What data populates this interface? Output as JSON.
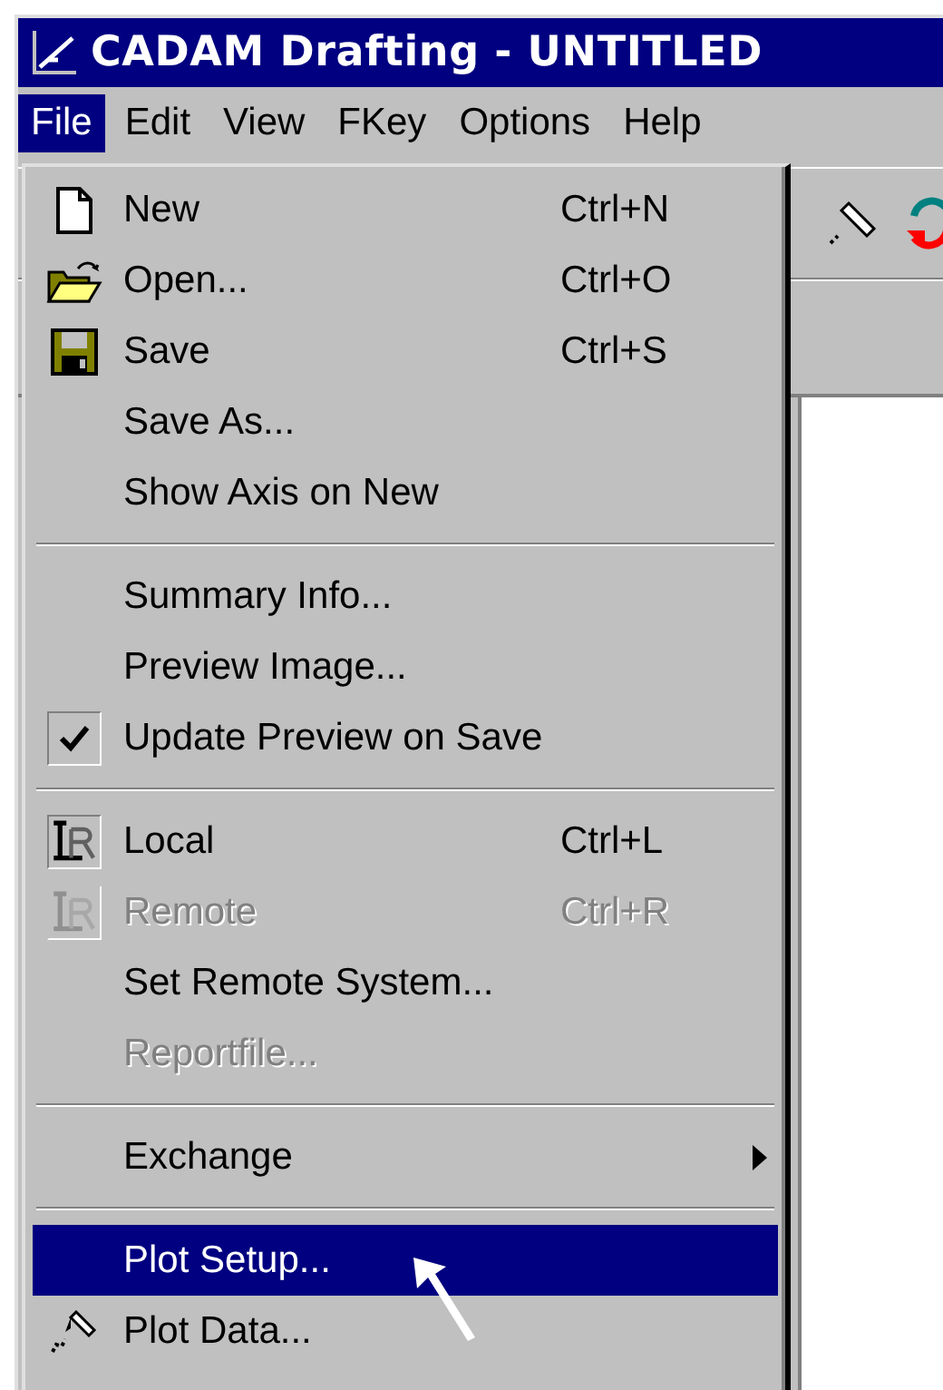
{
  "window": {
    "title": "CADAM Drafting - UNTITLED"
  },
  "menubar": [
    {
      "label": "File",
      "selected": true
    },
    {
      "label": "Edit",
      "selected": false
    },
    {
      "label": "View",
      "selected": false
    },
    {
      "label": "FKey",
      "selected": false
    },
    {
      "label": "Options",
      "selected": false
    },
    {
      "label": "Help",
      "selected": false
    }
  ],
  "file_menu": {
    "sections": [
      [
        {
          "kind": "icon",
          "label": "New",
          "shortcut": "Ctrl+N",
          "disabled": false,
          "selected": false
        },
        {
          "kind": "icon",
          "label": "Open...",
          "shortcut": "Ctrl+O",
          "disabled": false,
          "selected": false
        },
        {
          "kind": "icon",
          "label": "Save",
          "shortcut": "Ctrl+S",
          "disabled": false,
          "selected": false
        },
        {
          "kind": "plain",
          "label": "Save As...",
          "disabled": false,
          "selected": false
        },
        {
          "kind": "plain",
          "label": "Show Axis on New",
          "disabled": false,
          "selected": false
        }
      ],
      [
        {
          "kind": "plain",
          "label": "Summary Info...",
          "disabled": false,
          "selected": false
        },
        {
          "kind": "plain",
          "label": "Preview Image...",
          "disabled": false,
          "selected": false
        },
        {
          "kind": "check",
          "label": "Update Preview on Save",
          "checked": true,
          "disabled": false,
          "selected": false
        }
      ],
      [
        {
          "kind": "icon",
          "label": "Local",
          "shortcut": "Ctrl+L",
          "disabled": false,
          "selected": false,
          "checked": true
        },
        {
          "kind": "icon",
          "label": "Remote",
          "shortcut": "Ctrl+R",
          "disabled": true,
          "selected": false,
          "checked": false
        },
        {
          "kind": "plain",
          "label": "Set Remote System...",
          "disabled": false,
          "selected": false
        },
        {
          "kind": "plain",
          "label": "Reportfile...",
          "disabled": true,
          "selected": false
        }
      ],
      [
        {
          "kind": "submenu",
          "label": "Exchange",
          "disabled": false,
          "selected": false
        }
      ],
      [
        {
          "kind": "plain",
          "label": "Plot Setup...",
          "disabled": false,
          "selected": true
        },
        {
          "kind": "icon",
          "label": "Plot Data...",
          "disabled": false,
          "selected": false
        }
      ]
    ]
  }
}
